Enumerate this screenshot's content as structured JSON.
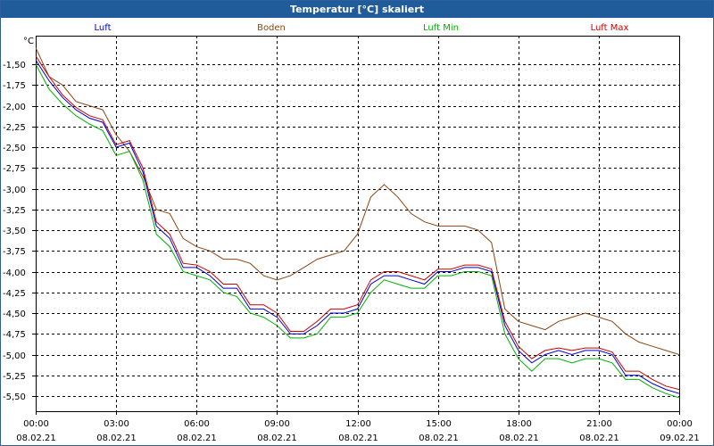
{
  "window": {
    "title": "Temperatur [°C] skaliert"
  },
  "chart_data": {
    "type": "line",
    "title": "Temperatur [°C] skaliert",
    "ylabel": "°C",
    "xlabel": "",
    "ylim": [
      -5.6,
      -1.0
    ],
    "grid": true,
    "legend_position": "top",
    "y_ticks": [
      "-1,50",
      "-1,75",
      "-2,00",
      "-2,25",
      "-2,50",
      "-2,75",
      "-3,00",
      "-3,25",
      "-3,50",
      "-3,75",
      "-4,00",
      "-4,25",
      "-4,50",
      "-4,75",
      "-5,00",
      "-5,25",
      "-5,50"
    ],
    "x_ticks": [
      {
        "time": "00:00",
        "date": "08.02.21"
      },
      {
        "time": "03:00",
        "date": "08.02.21"
      },
      {
        "time": "06:00",
        "date": "08.02.21"
      },
      {
        "time": "09:00",
        "date": "08.02.21"
      },
      {
        "time": "12:00",
        "date": "08.02.21"
      },
      {
        "time": "15:00",
        "date": "08.02.21"
      },
      {
        "time": "18:00",
        "date": "08.02.21"
      },
      {
        "time": "21:00",
        "date": "08.02.21"
      },
      {
        "time": "00:00",
        "date": "09.02.21"
      }
    ],
    "x_unit": "hours since 08.02.21 00:00",
    "series": [
      {
        "name": "Luft",
        "color": "#0000cc",
        "points": [
          [
            0,
            -1.45
          ],
          [
            0.5,
            -1.7
          ],
          [
            1.0,
            -1.9
          ],
          [
            1.5,
            -2.05
          ],
          [
            2.0,
            -2.15
          ],
          [
            2.5,
            -2.2
          ],
          [
            3.0,
            -2.5
          ],
          [
            3.5,
            -2.45
          ],
          [
            4.0,
            -2.8
          ],
          [
            4.5,
            -3.45
          ],
          [
            5.0,
            -3.6
          ],
          [
            5.5,
            -3.95
          ],
          [
            6.0,
            -3.95
          ],
          [
            6.5,
            -4.05
          ],
          [
            7.0,
            -4.2
          ],
          [
            7.5,
            -4.2
          ],
          [
            8.0,
            -4.45
          ],
          [
            8.5,
            -4.45
          ],
          [
            9.0,
            -4.55
          ],
          [
            9.5,
            -4.75
          ],
          [
            10.0,
            -4.75
          ],
          [
            10.5,
            -4.65
          ],
          [
            11.0,
            -4.5
          ],
          [
            11.5,
            -4.5
          ],
          [
            12.0,
            -4.45
          ],
          [
            12.5,
            -4.15
          ],
          [
            13.0,
            -4.05
          ],
          [
            13.5,
            -4.05
          ],
          [
            14.0,
            -4.1
          ],
          [
            14.5,
            -4.15
          ],
          [
            15.0,
            -4.0
          ],
          [
            15.5,
            -4.0
          ],
          [
            16.0,
            -3.95
          ],
          [
            16.5,
            -3.95
          ],
          [
            17.0,
            -4.0
          ],
          [
            17.5,
            -4.65
          ],
          [
            18.0,
            -4.95
          ],
          [
            18.5,
            -5.1
          ],
          [
            19.0,
            -5.0
          ],
          [
            19.5,
            -4.95
          ],
          [
            20.0,
            -5.0
          ],
          [
            20.5,
            -4.95
          ],
          [
            21.0,
            -4.95
          ],
          [
            21.5,
            -5.0
          ],
          [
            22.0,
            -5.25
          ],
          [
            22.5,
            -5.25
          ],
          [
            23.0,
            -5.35
          ],
          [
            23.5,
            -5.42
          ],
          [
            24.0,
            -5.47
          ]
        ]
      },
      {
        "name": "Boden",
        "color": "#8b4513",
        "points": [
          [
            0,
            -1.3
          ],
          [
            0.5,
            -1.65
          ],
          [
            1.0,
            -1.75
          ],
          [
            1.5,
            -1.95
          ],
          [
            2.0,
            -2.0
          ],
          [
            2.5,
            -2.05
          ],
          [
            3.0,
            -2.35
          ],
          [
            3.5,
            -2.55
          ],
          [
            4.0,
            -2.85
          ],
          [
            4.5,
            -3.25
          ],
          [
            5.0,
            -3.3
          ],
          [
            5.5,
            -3.6
          ],
          [
            6.0,
            -3.7
          ],
          [
            6.5,
            -3.75
          ],
          [
            7.0,
            -3.85
          ],
          [
            7.5,
            -3.85
          ],
          [
            8.0,
            -3.9
          ],
          [
            8.5,
            -4.05
          ],
          [
            9.0,
            -4.1
          ],
          [
            9.5,
            -4.05
          ],
          [
            10.0,
            -3.95
          ],
          [
            10.5,
            -3.85
          ],
          [
            11.0,
            -3.8
          ],
          [
            11.5,
            -3.75
          ],
          [
            12.0,
            -3.55
          ],
          [
            12.5,
            -3.1
          ],
          [
            13.0,
            -2.95
          ],
          [
            13.5,
            -3.1
          ],
          [
            14.0,
            -3.3
          ],
          [
            14.5,
            -3.4
          ],
          [
            15.0,
            -3.45
          ],
          [
            15.5,
            -3.45
          ],
          [
            16.0,
            -3.45
          ],
          [
            16.5,
            -3.5
          ],
          [
            17.0,
            -3.65
          ],
          [
            17.5,
            -4.45
          ],
          [
            18.0,
            -4.6
          ],
          [
            18.5,
            -4.65
          ],
          [
            19.0,
            -4.7
          ],
          [
            19.5,
            -4.6
          ],
          [
            20.0,
            -4.55
          ],
          [
            20.5,
            -4.5
          ],
          [
            21.0,
            -4.55
          ],
          [
            21.5,
            -4.6
          ],
          [
            22.0,
            -4.75
          ],
          [
            22.5,
            -4.85
          ],
          [
            23.0,
            -4.9
          ],
          [
            23.5,
            -4.95
          ],
          [
            24.0,
            -5.0
          ]
        ]
      },
      {
        "name": "Luft Min",
        "color": "#00b000",
        "points": [
          [
            0,
            -1.5
          ],
          [
            0.5,
            -1.8
          ],
          [
            1.0,
            -1.98
          ],
          [
            1.5,
            -2.12
          ],
          [
            2.0,
            -2.22
          ],
          [
            2.5,
            -2.3
          ],
          [
            3.0,
            -2.6
          ],
          [
            3.5,
            -2.55
          ],
          [
            4.0,
            -2.9
          ],
          [
            4.5,
            -3.55
          ],
          [
            5.0,
            -3.7
          ],
          [
            5.5,
            -4.0
          ],
          [
            6.0,
            -4.05
          ],
          [
            6.5,
            -4.1
          ],
          [
            7.0,
            -4.25
          ],
          [
            7.5,
            -4.3
          ],
          [
            8.0,
            -4.5
          ],
          [
            8.5,
            -4.55
          ],
          [
            9.0,
            -4.65
          ],
          [
            9.5,
            -4.8
          ],
          [
            10.0,
            -4.8
          ],
          [
            10.5,
            -4.75
          ],
          [
            11.0,
            -4.55
          ],
          [
            11.5,
            -4.55
          ],
          [
            12.0,
            -4.5
          ],
          [
            12.5,
            -4.25
          ],
          [
            13.0,
            -4.1
          ],
          [
            13.5,
            -4.15
          ],
          [
            14.0,
            -4.2
          ],
          [
            14.5,
            -4.2
          ],
          [
            15.0,
            -4.05
          ],
          [
            15.5,
            -4.05
          ],
          [
            16.0,
            -4.0
          ],
          [
            16.5,
            -4.0
          ],
          [
            17.0,
            -4.05
          ],
          [
            17.5,
            -4.75
          ],
          [
            18.0,
            -5.05
          ],
          [
            18.5,
            -5.2
          ],
          [
            19.0,
            -5.05
          ],
          [
            19.5,
            -5.05
          ],
          [
            20.0,
            -5.1
          ],
          [
            20.5,
            -5.05
          ],
          [
            21.0,
            -5.05
          ],
          [
            21.5,
            -5.1
          ],
          [
            22.0,
            -5.3
          ],
          [
            22.5,
            -5.3
          ],
          [
            23.0,
            -5.4
          ],
          [
            23.5,
            -5.47
          ],
          [
            24.0,
            -5.52
          ]
        ]
      },
      {
        "name": "Luft Max",
        "color": "#cc0000",
        "points": [
          [
            0,
            -1.4
          ],
          [
            0.5,
            -1.65
          ],
          [
            1.0,
            -1.87
          ],
          [
            1.5,
            -2.02
          ],
          [
            2.0,
            -2.12
          ],
          [
            2.5,
            -2.17
          ],
          [
            3.0,
            -2.47
          ],
          [
            3.5,
            -2.42
          ],
          [
            4.0,
            -2.75
          ],
          [
            4.5,
            -3.4
          ],
          [
            5.0,
            -3.55
          ],
          [
            5.5,
            -3.9
          ],
          [
            6.0,
            -3.92
          ],
          [
            6.5,
            -4.0
          ],
          [
            7.0,
            -4.15
          ],
          [
            7.5,
            -4.15
          ],
          [
            8.0,
            -4.4
          ],
          [
            8.5,
            -4.4
          ],
          [
            9.0,
            -4.5
          ],
          [
            9.5,
            -4.72
          ],
          [
            10.0,
            -4.72
          ],
          [
            10.5,
            -4.6
          ],
          [
            11.0,
            -4.45
          ],
          [
            11.5,
            -4.45
          ],
          [
            12.0,
            -4.4
          ],
          [
            12.5,
            -4.1
          ],
          [
            13.0,
            -4.0
          ],
          [
            13.5,
            -4.0
          ],
          [
            14.0,
            -4.05
          ],
          [
            14.5,
            -4.1
          ],
          [
            15.0,
            -3.97
          ],
          [
            15.5,
            -3.97
          ],
          [
            16.0,
            -3.92
          ],
          [
            16.5,
            -3.92
          ],
          [
            17.0,
            -3.97
          ],
          [
            17.5,
            -4.6
          ],
          [
            18.0,
            -4.9
          ],
          [
            18.5,
            -5.05
          ],
          [
            19.0,
            -4.95
          ],
          [
            19.5,
            -4.92
          ],
          [
            20.0,
            -4.95
          ],
          [
            20.5,
            -4.92
          ],
          [
            21.0,
            -4.92
          ],
          [
            21.5,
            -4.97
          ],
          [
            22.0,
            -5.2
          ],
          [
            22.5,
            -5.2
          ],
          [
            23.0,
            -5.3
          ],
          [
            23.5,
            -5.38
          ],
          [
            24.0,
            -5.42
          ]
        ]
      }
    ]
  }
}
